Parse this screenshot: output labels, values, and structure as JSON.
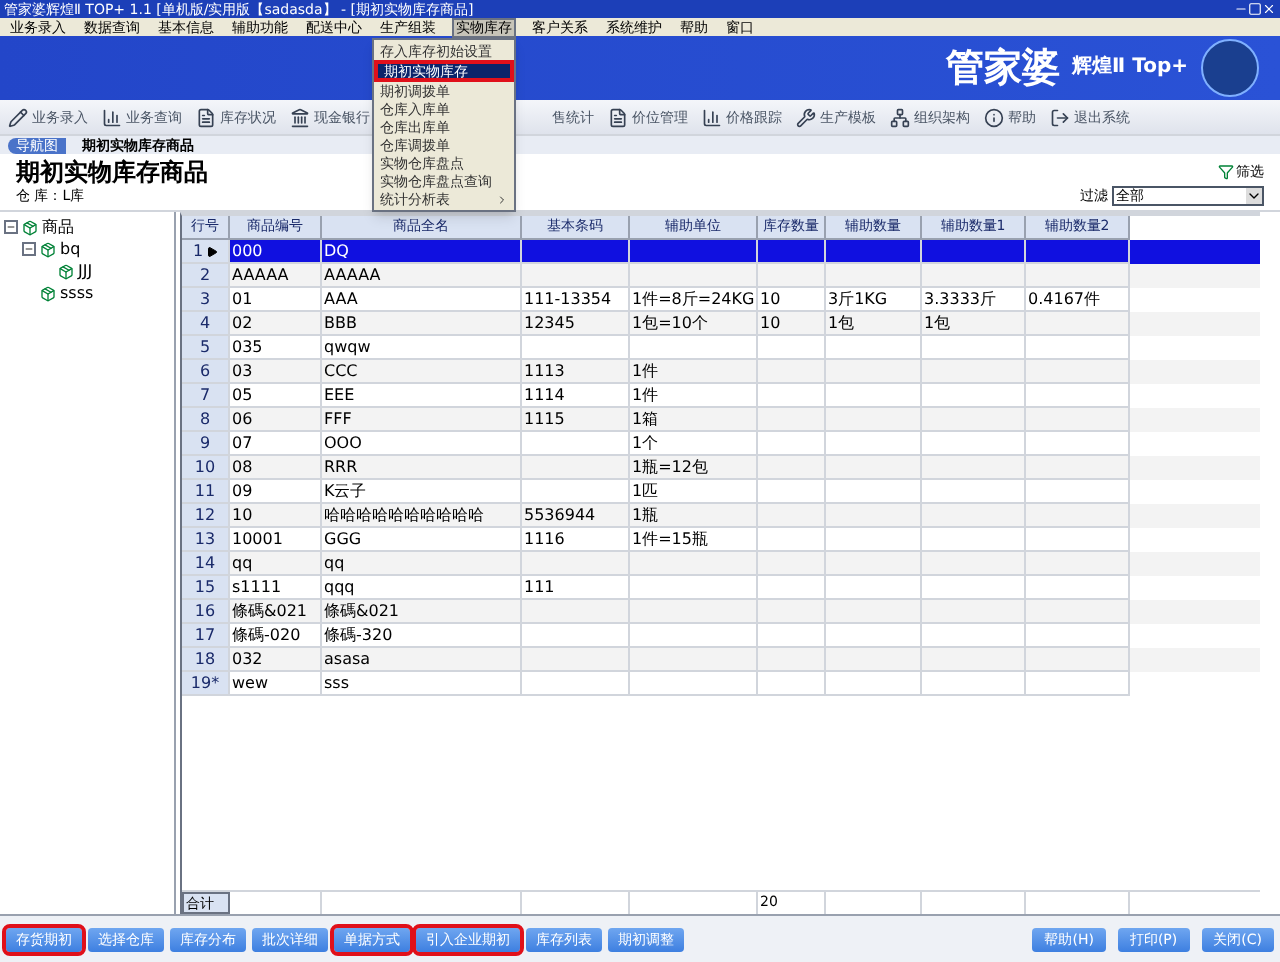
{
  "window": {
    "title": "管家婆辉煌Ⅱ TOP+ 1.1 [单机版/实用版【sadasda】 - [期初实物库存商品]"
  },
  "menu": [
    {
      "label": "业务录入",
      "open": false
    },
    {
      "label": "数据查询",
      "open": false
    },
    {
      "label": "基本信息",
      "open": false
    },
    {
      "label": "辅助功能",
      "open": false
    },
    {
      "label": "配送中心",
      "open": false
    },
    {
      "label": "生产组装",
      "open": false
    },
    {
      "label": "实物库存",
      "open": true
    },
    {
      "label": "客户关系",
      "open": false
    },
    {
      "label": "系统维护",
      "open": false
    },
    {
      "label": "帮助",
      "open": false
    },
    {
      "label": "窗口",
      "open": false
    }
  ],
  "dropdown": [
    {
      "label": "存入库存初始设置",
      "selected": false,
      "submenu": false
    },
    {
      "label": "期初实物库存",
      "selected": true,
      "submenu": false
    },
    {
      "label": "期初调拨单",
      "selected": false,
      "submenu": false
    },
    {
      "label": "仓库入库单",
      "selected": false,
      "submenu": false
    },
    {
      "label": "仓库出库单",
      "selected": false,
      "submenu": false
    },
    {
      "label": "仓库调拨单",
      "selected": false,
      "submenu": false
    },
    {
      "label": "实物仓库盘点",
      "selected": false,
      "submenu": false
    },
    {
      "label": "实物仓库盘点查询",
      "selected": false,
      "submenu": false
    },
    {
      "label": "统计分析表",
      "selected": false,
      "submenu": true
    }
  ],
  "banner": {
    "brand": "管家婆",
    "edition": "辉煌Ⅱ Top+"
  },
  "toolbar": [
    {
      "label": "业务录入",
      "kind": "pencil"
    },
    {
      "label": "业务查询",
      "kind": "chart"
    },
    {
      "label": "库存状况",
      "kind": "doc"
    },
    {
      "label": "现金银行",
      "kind": "bank"
    },
    {
      "label": "售统计",
      "kind": "none"
    },
    {
      "label": "价位管理",
      "kind": "doc"
    },
    {
      "label": "价格跟踪",
      "kind": "chart"
    },
    {
      "label": "生产模板",
      "kind": "tools"
    },
    {
      "label": "组织架构",
      "kind": "org"
    },
    {
      "label": "帮助",
      "kind": "info"
    },
    {
      "label": "退出系统",
      "kind": "exit"
    }
  ],
  "tabs": [
    {
      "label": "导航图",
      "selected": false
    },
    {
      "label": "期初实物库存商品",
      "selected": true
    }
  ],
  "heading": "期初实物库存商品",
  "warehouse": "仓 库：L库",
  "filter_button": "筛选",
  "filter": {
    "label": "过滤",
    "value": "全部"
  },
  "tree": [
    {
      "label": "商品",
      "expanded": true,
      "children": [
        {
          "label": "bq",
          "expanded": true,
          "children": [
            {
              "label": "JJJ"
            }
          ]
        },
        {
          "label": "ssss"
        }
      ]
    }
  ],
  "table": {
    "columns": [
      "行号",
      "商品编号",
      "商品全名",
      "基本条码",
      "辅助单位",
      "库存数量",
      "辅助数量",
      "辅助数量1",
      "辅助数量2"
    ],
    "rows": [
      {
        "selected": true,
        "cells": [
          "1",
          "000",
          "DQ",
          "",
          "",
          "",
          "",
          "",
          ""
        ]
      },
      {
        "selected": false,
        "cells": [
          "2",
          "AAAAA",
          "AAAAA",
          "",
          "",
          "",
          "",
          "",
          ""
        ]
      },
      {
        "selected": false,
        "cells": [
          "3",
          "01",
          "AAA",
          "111-13354",
          "1件=8斤=24KG",
          "10",
          "3斤1KG",
          "3.3333斤",
          "0.4167件"
        ]
      },
      {
        "selected": false,
        "cells": [
          "4",
          "02",
          "BBB",
          "12345",
          "1包=10个",
          "10",
          "1包",
          "1包",
          ""
        ]
      },
      {
        "selected": false,
        "cells": [
          "5",
          "035",
          "qwqw",
          "",
          "",
          "",
          "",
          "",
          ""
        ]
      },
      {
        "selected": false,
        "cells": [
          "6",
          "03",
          "CCC",
          "1113",
          "1件",
          "",
          "",
          "",
          ""
        ]
      },
      {
        "selected": false,
        "cells": [
          "7",
          "05",
          "EEE",
          "1114",
          "1件",
          "",
          "",
          "",
          ""
        ]
      },
      {
        "selected": false,
        "cells": [
          "8",
          "06",
          "FFF",
          "1115",
          "1箱",
          "",
          "",
          "",
          ""
        ]
      },
      {
        "selected": false,
        "cells": [
          "9",
          "07",
          "OOO",
          "",
          "1个",
          "",
          "",
          "",
          ""
        ]
      },
      {
        "selected": false,
        "cells": [
          "10",
          "08",
          "RRR",
          "",
          "1瓶=12包",
          "",
          "",
          "",
          ""
        ]
      },
      {
        "selected": false,
        "cells": [
          "11",
          "09",
          "K云子",
          "",
          "1匹",
          "",
          "",
          "",
          ""
        ]
      },
      {
        "selected": false,
        "cells": [
          "12",
          "10",
          "哈哈哈哈哈哈哈哈哈哈",
          "5536944",
          "1瓶",
          "",
          "",
          "",
          ""
        ]
      },
      {
        "selected": false,
        "cells": [
          "13",
          "10001",
          "GGG",
          "1116",
          "1件=15瓶",
          "",
          "",
          "",
          ""
        ]
      },
      {
        "selected": false,
        "cells": [
          "14",
          "qq",
          "qq",
          "",
          "",
          "",
          "",
          "",
          ""
        ]
      },
      {
        "selected": false,
        "cells": [
          "15",
          "s1111",
          "qqq",
          "111",
          "",
          "",
          "",
          "",
          ""
        ]
      },
      {
        "selected": false,
        "cells": [
          "16",
          "條碼&021",
          "條碼&021",
          "",
          "",
          "",
          "",
          "",
          ""
        ]
      },
      {
        "selected": false,
        "cells": [
          "17",
          "條碼-020",
          "條碼-320",
          "",
          "",
          "",
          "",
          "",
          ""
        ]
      },
      {
        "selected": false,
        "cells": [
          "18",
          "032",
          "asasa",
          "",
          "",
          "",
          "",
          "",
          ""
        ]
      },
      {
        "selected": false,
        "cells": [
          "19*",
          "wew",
          "sss",
          "",
          "",
          "",
          "",
          "",
          ""
        ]
      }
    ],
    "footer": {
      "label": "合计",
      "quantity_total": "20"
    }
  },
  "buttons": [
    {
      "label": "存货期初",
      "highlighted": true
    },
    {
      "label": "选择仓库",
      "highlighted": false
    },
    {
      "label": "库存分布",
      "highlighted": false
    },
    {
      "label": "批次详细",
      "highlighted": false
    },
    {
      "label": "单据方式",
      "highlighted": true
    },
    {
      "label": "引入企业期初",
      "highlighted": true
    },
    {
      "label": "库存列表",
      "highlighted": false
    },
    {
      "label": "期初调整",
      "highlighted": false
    }
  ],
  "right_buttons": [
    "帮助(H)",
    "打印(P)",
    "关闭(C)"
  ]
}
